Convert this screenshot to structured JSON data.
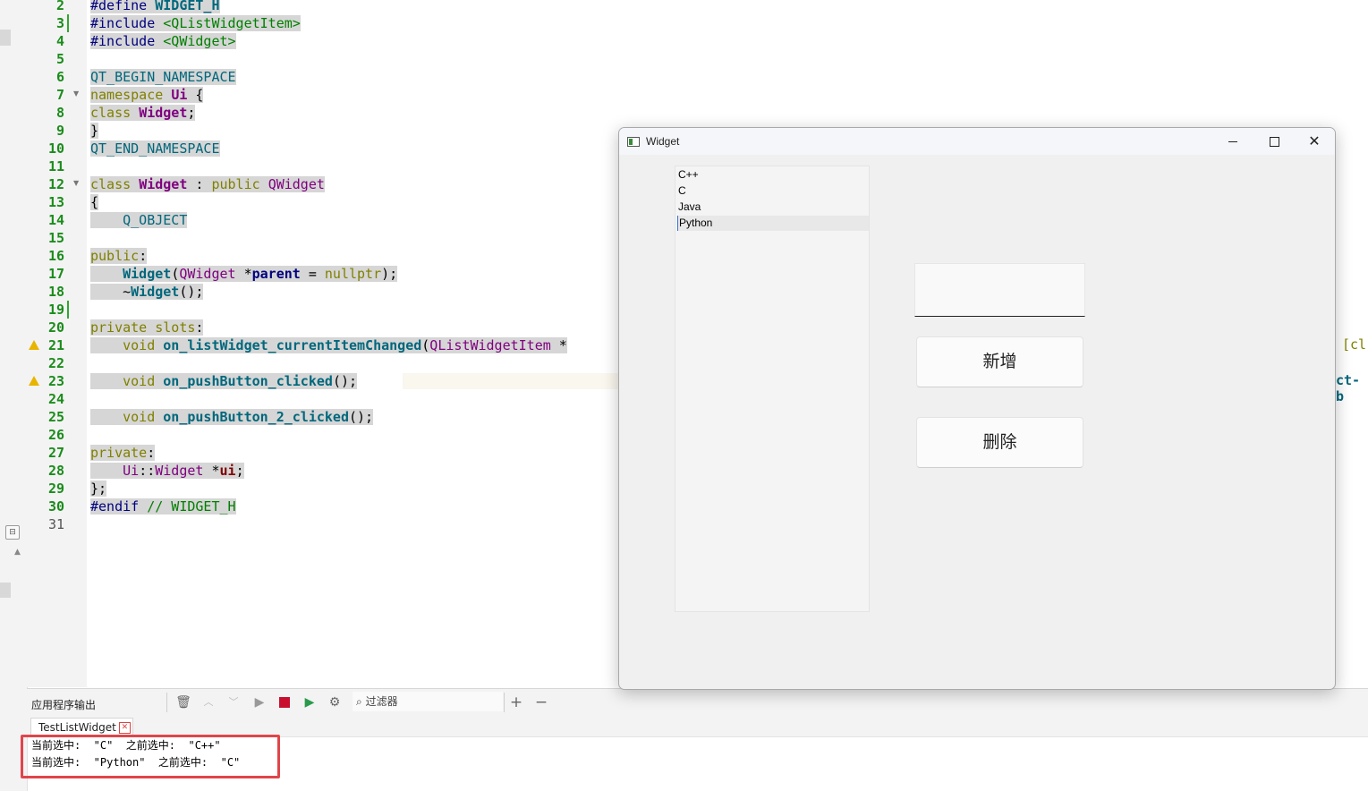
{
  "editor": {
    "line_numbers": [
      "2",
      "3",
      "4",
      "5",
      "6",
      "7",
      "8",
      "9",
      "10",
      "11",
      "12",
      "13",
      "14",
      "15",
      "16",
      "17",
      "18",
      "19",
      "20",
      "21",
      "22",
      "23",
      "24",
      "25",
      "26",
      "27",
      "28",
      "29",
      "30",
      "31"
    ],
    "code": {
      "l2a": "#define ",
      "l2b": "WIDGET_H",
      "l3a": "#include ",
      "l3b": "<QListWidgetItem>",
      "l4a": "#include ",
      "l4b": "<QWidget>",
      "l6": "QT_BEGIN_NAMESPACE",
      "l7a": "namespace ",
      "l7b": "Ui",
      "l7c": " {",
      "l8a": "class ",
      "l8b": "Widget",
      "l8c": ";",
      "l9": "}",
      "l10": "QT_END_NAMESPACE",
      "l12a": "class ",
      "l12b": "Widget",
      "l12c": " : ",
      "l12d": "public ",
      "l12e": "QWidget",
      "l13": "{",
      "l14": "    Q_OBJECT",
      "l16a": "public",
      "l16b": ":",
      "l17a": "    ",
      "l17b": "Widget",
      "l17c": "(",
      "l17d": "QWidget",
      "l17e": " *",
      "l17f": "parent",
      "l17g": " = ",
      "l17h": "nullptr",
      "l17i": ");",
      "l18a": "    ~",
      "l18b": "Widget",
      "l18c": "();",
      "l20a": "private slots",
      "l20b": ":",
      "l21a": "    ",
      "l21b": "void ",
      "l21c": "on_listWidget_currentItemChanged",
      "l21d": "(",
      "l21e": "QListWidgetItem",
      "l21f": " *",
      "l23a": "    ",
      "l23b": "void ",
      "l23c": "on_pushButton_clicked",
      "l23d": "();",
      "l25a": "    ",
      "l25b": "void ",
      "l25c": "on_pushButton_2_clicked",
      "l25d": "();",
      "l27a": "private",
      "l27b": ":",
      "l28a": "    ",
      "l28b": "Ui",
      "l28c": "::",
      "l28d": "Widget",
      "l28e": " *",
      "l28f": "ui",
      "l28g": ";",
      "l29": "};",
      "l30a": "#endif ",
      "l30b": "// WIDGET_H"
    },
    "clipped_right_1": "[cl",
    "clipped_right_2": "ct-b"
  },
  "output_pane": {
    "title": "应用程序输出",
    "filter_placeholder": "过滤器",
    "tab_label": "TestListWidget",
    "lines": [
      "当前选中:  \"C\"  之前选中:  \"C++\"",
      "当前选中:  \"Python\"  之前选中:  \"C\""
    ]
  },
  "widget_window": {
    "title": "Widget",
    "list_items": [
      "C++",
      "C",
      "Java",
      "Python"
    ],
    "current_item": "Python",
    "line_edit_value": "",
    "add_button": "新增",
    "delete_button": "删除"
  }
}
